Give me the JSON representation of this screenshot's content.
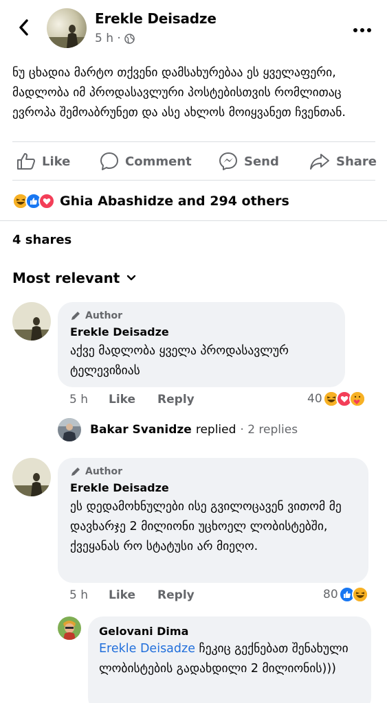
{
  "post": {
    "author": "Erekle Deisadze",
    "time": "5 h ·",
    "text": "ნუ ცხადია მარტო თქვენი დამსახურებაა ეს ყველაფერი, მადლობა იმ პროდასავლური პოსტებისთვის რომლითაც ევროპა შემოაბრუნეთ და ასე ახლოს მოიყვანეთ ჩვენთან."
  },
  "actions": {
    "like": "Like",
    "comment": "Comment",
    "send": "Send",
    "share": "Share"
  },
  "reactions_summary": "Ghia Abashidze and 294 others",
  "shares": "4 shares",
  "sort_label": "Most relevant",
  "comments": [
    {
      "badge": "Author",
      "name": "Erekle Deisadze",
      "text": "აქვე მადლობა ყველა პროდასავლურ ტელევიზიას",
      "time": "5 h",
      "like": "Like",
      "reply": "Reply",
      "reaction_count": "40"
    },
    {
      "badge": "Author",
      "name": "Erekle Deisadze",
      "text": "ეს დედამოხნულები ისე გვილოცავენ ვითომ მე დავხარჯე 2 მილიონი უცხოელ ლობისტებში, ქვეყანას რო სტატუსი არ მიეღო.",
      "time": "5 h",
      "like": "Like",
      "reply": "Reply",
      "reaction_count": "80"
    }
  ],
  "replies_row": {
    "name": "Bakar Svanidze",
    "action": "replied",
    "count": "· 2 replies"
  },
  "nested_reply": {
    "name": "Gelovani Dima",
    "mention": "Erekle Deisadze",
    "text": "ჩეკიც გექნებათ შენახული ლობისტების  გადახდილი 2 მილიონის)))"
  },
  "colors": {
    "like_blue": "#1877f2",
    "love_red": "#f33e58",
    "haha_yellow": "#f7b125",
    "mention_blue": "#216fdb",
    "muted": "#65676b"
  }
}
